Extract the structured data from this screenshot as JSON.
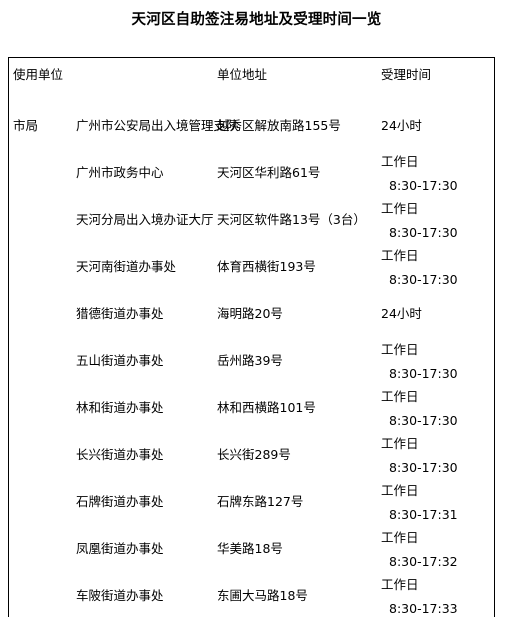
{
  "document": {
    "title": "天河区自助签注易地址及受理时间一览"
  },
  "table": {
    "headers": {
      "org": "使用单位",
      "unit": "",
      "address": "单位地址",
      "time": "受理时间"
    },
    "rows": [
      {
        "org": "市局",
        "unit": "广州市公安局出入境管理支队",
        "address": "越秀区解放南路155号",
        "time_label": "24小时",
        "time_hours": ""
      },
      {
        "org": "",
        "unit": "广州市政务中心",
        "address": "天河区华利路61号",
        "time_label": "工作日",
        "time_hours": "8:30-17:30"
      },
      {
        "org": "",
        "unit": "天河分局出入境办证大厅",
        "address": "天河区软件路13号（3台）",
        "time_label": "工作日",
        "time_hours": "8:30-17:30"
      },
      {
        "org": "",
        "unit": "天河南街道办事处",
        "address": "体育西横街193号",
        "time_label": "工作日",
        "time_hours": "8:30-17:30"
      },
      {
        "org": "",
        "unit": "猎德街道办事处",
        "address": "海明路20号",
        "time_label": "24小时",
        "time_hours": ""
      },
      {
        "org": "",
        "unit": "五山街道办事处",
        "address": "岳州路39号",
        "time_label": "工作日",
        "time_hours": "8:30-17:30"
      },
      {
        "org": "",
        "unit": "林和街道办事处",
        "address": "林和西横路101号",
        "time_label": "工作日",
        "time_hours": "8:30-17:30"
      },
      {
        "org": "",
        "unit": "长兴街道办事处",
        "address": "长兴街289号",
        "time_label": "工作日",
        "time_hours": "8:30-17:30"
      },
      {
        "org": "",
        "unit": "石牌街道办事处",
        "address": "石牌东路127号",
        "time_label": "工作日",
        "time_hours": "8:30-17:31"
      },
      {
        "org": "",
        "unit": "凤凰街道办事处",
        "address": "华美路18号",
        "time_label": "工作日",
        "time_hours": "8:30-17:32"
      },
      {
        "org": "",
        "unit": "车陂街道办事处",
        "address": "东圃大马路18号",
        "time_label": "工作日",
        "time_hours": "8:30-17:33"
      }
    ]
  },
  "colors": {
    "text": "#000000",
    "background": "#ffffff",
    "border": "#000000"
  }
}
